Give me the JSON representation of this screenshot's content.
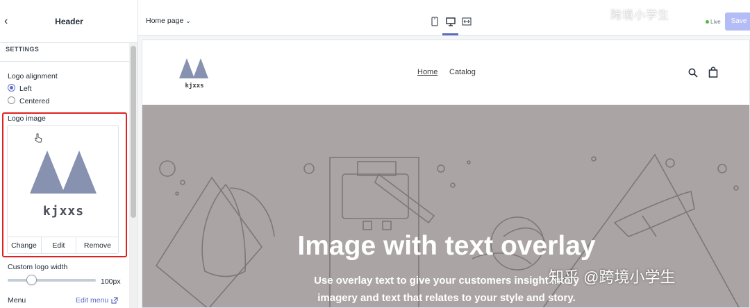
{
  "sidebar": {
    "title": "Header",
    "section": "SETTINGS",
    "logo_alignment": {
      "label": "Logo alignment",
      "options": [
        "Left",
        "Centered"
      ],
      "selected": "Left"
    },
    "logo_image": {
      "label": "Logo image",
      "preview_text": "kjxxs",
      "actions": [
        "Change",
        "Edit",
        "Remove"
      ]
    },
    "custom_logo_width": {
      "label": "Custom logo width",
      "value": "100px",
      "slider_fraction": 0.27
    },
    "menu": {
      "label": "Menu",
      "edit_link": "Edit menu"
    }
  },
  "topbar": {
    "page_select": "Home page",
    "device_icons": [
      "mobile-icon",
      "desktop-icon",
      "fullscreen-icon"
    ],
    "status": "Live",
    "save_label": "Save",
    "watermark": "跨境小学生"
  },
  "preview": {
    "logo_text": "kjxxs",
    "nav": [
      "Home",
      "Catalog"
    ],
    "hero_title": "Image with text overlay",
    "hero_line1": "Use overlay text to give your customers insight into y",
    "hero_line2": "imagery and text that relates to your style and story.",
    "watermark": "知乎 @跨境小学生"
  },
  "colors": {
    "accent": "#5c6ac4",
    "highlight": "#e02020",
    "logo": "#8791b0",
    "hero_bg": "#aba4a4"
  }
}
